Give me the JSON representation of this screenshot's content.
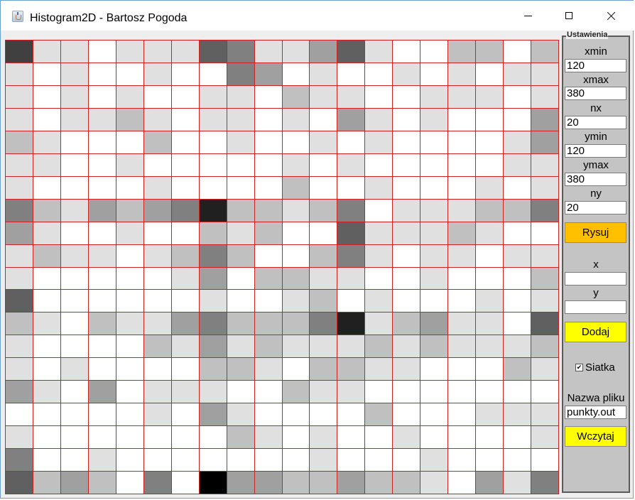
{
  "window": {
    "title": "Histogram2D - Bartosz Pogoda"
  },
  "histogram": {
    "gridlines": true,
    "gridline_color": "#cc2222",
    "palette": [
      "#ffffff",
      "#e0e0e0",
      "#c0c0c0",
      "#a0a0a0",
      "#808080",
      "#606060",
      "#404040",
      "#202020",
      "#000000"
    ],
    "rows": [
      [
        6,
        1,
        1,
        0,
        1,
        1,
        1,
        5,
        4,
        1,
        1,
        3,
        5,
        1,
        0,
        0,
        2,
        2,
        0,
        2
      ],
      [
        1,
        0,
        1,
        0,
        0,
        1,
        0,
        0,
        4,
        3,
        0,
        1,
        0,
        0,
        1,
        0,
        1,
        0,
        1,
        1
      ],
      [
        1,
        0,
        1,
        0,
        1,
        0,
        0,
        1,
        1,
        0,
        2,
        1,
        1,
        0,
        0,
        1,
        1,
        1,
        0,
        1
      ],
      [
        1,
        0,
        1,
        1,
        2,
        1,
        0,
        1,
        1,
        0,
        1,
        0,
        3,
        1,
        0,
        1,
        0,
        0,
        0,
        3
      ],
      [
        2,
        1,
        0,
        0,
        0,
        2,
        0,
        0,
        1,
        0,
        0,
        1,
        0,
        1,
        0,
        0,
        0,
        0,
        1,
        3
      ],
      [
        1,
        1,
        0,
        0,
        1,
        0,
        0,
        0,
        0,
        0,
        1,
        0,
        1,
        0,
        0,
        0,
        0,
        0,
        1,
        1
      ],
      [
        1,
        0,
        0,
        0,
        0,
        1,
        0,
        0,
        0,
        0,
        2,
        0,
        0,
        1,
        0,
        0,
        0,
        1,
        0,
        1
      ],
      [
        4,
        2,
        1,
        3,
        2,
        3,
        4,
        7,
        2,
        2,
        1,
        2,
        4,
        0,
        1,
        1,
        1,
        2,
        2,
        4
      ],
      [
        3,
        1,
        0,
        0,
        1,
        0,
        0,
        2,
        1,
        2,
        0,
        0,
        5,
        1,
        1,
        1,
        2,
        1,
        0,
        0
      ],
      [
        1,
        2,
        1,
        1,
        0,
        1,
        2,
        4,
        2,
        0,
        0,
        2,
        4,
        1,
        0,
        1,
        1,
        0,
        1,
        1
      ],
      [
        1,
        0,
        0,
        0,
        0,
        0,
        1,
        3,
        0,
        2,
        2,
        1,
        1,
        0,
        0,
        1,
        0,
        0,
        0,
        2
      ],
      [
        5,
        0,
        0,
        0,
        0,
        0,
        0,
        1,
        0,
        0,
        1,
        2,
        0,
        1,
        0,
        0,
        0,
        1,
        0,
        1
      ],
      [
        2,
        1,
        0,
        2,
        1,
        1,
        3,
        4,
        2,
        2,
        2,
        4,
        7,
        1,
        2,
        3,
        1,
        1,
        0,
        5
      ],
      [
        1,
        0,
        0,
        0,
        0,
        2,
        1,
        3,
        1,
        2,
        1,
        1,
        1,
        2,
        1,
        2,
        1,
        1,
        1,
        2
      ],
      [
        1,
        0,
        1,
        0,
        0,
        0,
        0,
        2,
        2,
        1,
        0,
        2,
        2,
        1,
        1,
        0,
        0,
        0,
        2,
        1
      ],
      [
        3,
        1,
        0,
        3,
        0,
        1,
        1,
        1,
        0,
        0,
        2,
        1,
        1,
        0,
        0,
        0,
        0,
        0,
        0,
        0
      ],
      [
        0,
        0,
        0,
        0,
        0,
        1,
        0,
        3,
        1,
        0,
        0,
        0,
        0,
        2,
        0,
        0,
        0,
        1,
        1,
        1
      ],
      [
        1,
        0,
        0,
        0,
        0,
        0,
        0,
        0,
        2,
        1,
        0,
        1,
        0,
        0,
        1,
        0,
        0,
        0,
        0,
        1
      ],
      [
        4,
        0,
        0,
        1,
        0,
        0,
        0,
        0,
        0,
        0,
        0,
        1,
        0,
        0,
        0,
        1,
        0,
        0,
        0,
        0
      ],
      [
        5,
        2,
        3,
        2,
        0,
        4,
        0,
        8,
        3,
        3,
        2,
        2,
        3,
        2,
        2,
        1,
        0,
        3,
        1,
        4
      ]
    ]
  },
  "panel": {
    "legend": "Ustawienia",
    "xmin_label": "xmin",
    "xmin_value": "120",
    "xmax_label": "xmax",
    "xmax_value": "380",
    "nx_label": "nx",
    "nx_value": "20",
    "ymin_label": "ymin",
    "ymin_value": "120",
    "ymax_label": "ymax",
    "ymax_value": "380",
    "ny_label": "ny",
    "ny_value": "20",
    "draw_button": "Rysuj",
    "x_label": "x",
    "x_value": "",
    "y_label": "y",
    "y_value": "",
    "add_button": "Dodaj",
    "grid_checkbox_label": "Siatka",
    "grid_checkbox_checked": true,
    "grid_checkbox_mark": "✔",
    "filename_label": "Nazwa pliku",
    "filename_value": "punkty.out",
    "load_button": "Wczytaj"
  }
}
